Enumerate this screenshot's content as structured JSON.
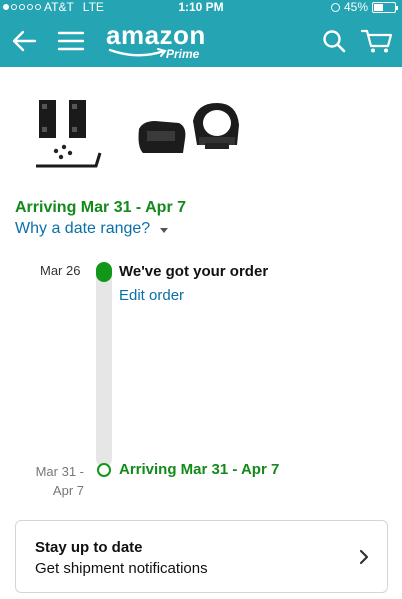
{
  "status_bar": {
    "carrier": "AT&T",
    "network": "LTE",
    "time": "1:10 PM",
    "battery": "45%",
    "battery_level": 0.45,
    "signal_bars": 1
  },
  "header": {
    "logo_text": "amazon",
    "logo_sub": "Prime",
    "icons": [
      "back-arrow-icon",
      "menu-icon",
      "search-icon",
      "cart-icon"
    ]
  },
  "shipment": {
    "arriving": "Arriving Mar 31 - Apr 7",
    "why_range": "Why a date range?"
  },
  "timeline": {
    "event1": {
      "date": "Mar 26",
      "title": "We've got your order",
      "action": "Edit order"
    },
    "event2": {
      "date_line1": "Mar 31 -",
      "date_line2": "Apr 7",
      "title": "Arriving Mar 31 - Apr 7"
    }
  },
  "notifications_card": {
    "title": "Stay up to date",
    "subtitle": "Get shipment notifications"
  },
  "colors": {
    "header": "#25a4b3",
    "green": "#138a1b",
    "link": "#0b6fa8"
  }
}
